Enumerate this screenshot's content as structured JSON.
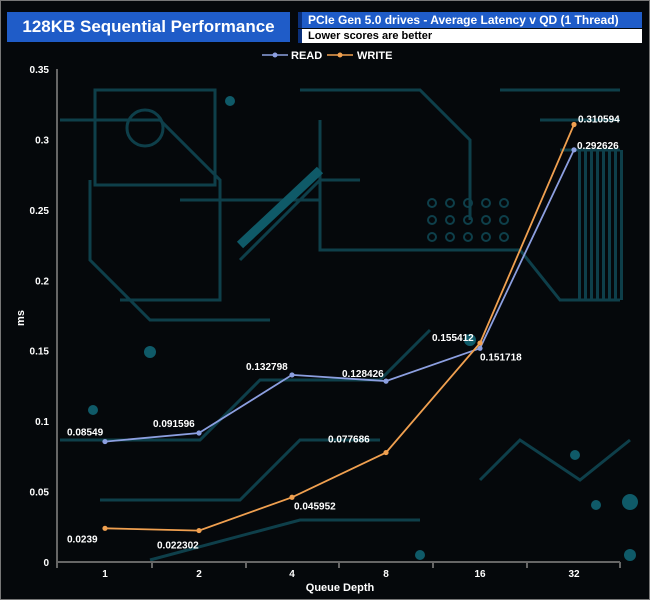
{
  "header": {
    "title": "128KB Sequential Performance",
    "subtitle": "PCIe Gen 5.0 drives - Average Latency v QD (1 Thread)",
    "note": "Lower scores are better"
  },
  "colors": {
    "read": "#8c9fe0",
    "write": "#f0a050",
    "header_bg": "#1f5cc8",
    "circuit": "#0e3f4a"
  },
  "chart_data": {
    "type": "line",
    "categories": [
      "1",
      "2",
      "4",
      "8",
      "16",
      "32"
    ],
    "series": [
      {
        "name": "READ",
        "values": [
          0.08549,
          0.091596,
          0.132798,
          0.128426,
          0.151718,
          0.292626
        ],
        "labels": [
          "0.08549",
          "0.091596",
          "0.132798",
          "0.128426",
          "0.151718",
          "0.292626"
        ]
      },
      {
        "name": "WRITE",
        "values": [
          0.0239,
          0.022302,
          0.045952,
          0.077686,
          0.155412,
          0.310594
        ],
        "labels": [
          "0.0239",
          "0.022302",
          "0.045952",
          "0.077686",
          "0.155412",
          "0.310594"
        ]
      }
    ],
    "xlabel": "Queue Depth",
    "ylabel": "ms",
    "ylim": [
      0,
      0.35
    ],
    "yticks": [
      "0",
      "0.05",
      "0.1",
      "0.15",
      "0.2",
      "0.25",
      "0.3",
      "0.35"
    ],
    "ytick_values": [
      0,
      0.05,
      0.1,
      0.15,
      0.2,
      0.25,
      0.3,
      0.35
    ],
    "legend": "top-center",
    "grid": false
  }
}
